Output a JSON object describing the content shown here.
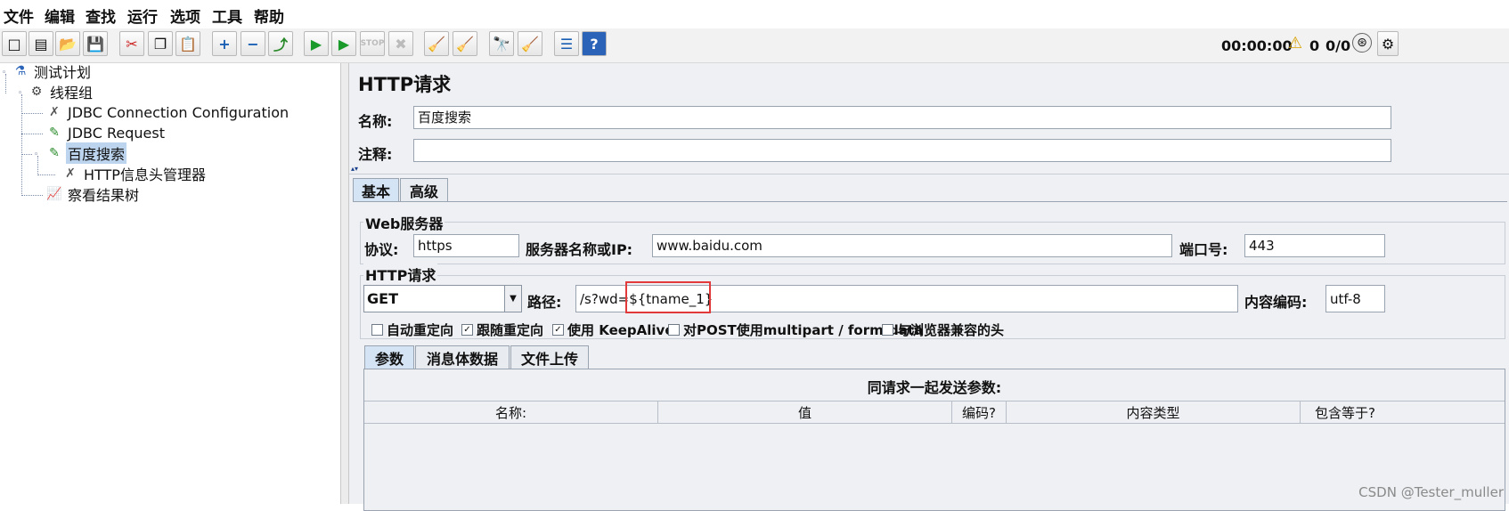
{
  "menu": [
    "文件",
    "编辑",
    "查找",
    "运行",
    "选项",
    "工具",
    "帮助"
  ],
  "status": {
    "elapsed": "00:00:00",
    "warning_count": "0",
    "threads": "0/0"
  },
  "tree": {
    "items": [
      {
        "label": "测试计划",
        "icon": "test-plan-icon"
      },
      {
        "label": "线程组",
        "icon": "gear-icon"
      },
      {
        "label": "JDBC Connection Configuration",
        "icon": "wrench-icon"
      },
      {
        "label": "JDBC Request",
        "icon": "pipette-icon"
      },
      {
        "label": "百度搜索",
        "icon": "pipette-icon",
        "selected": true
      },
      {
        "label": "HTTP信息头管理器",
        "icon": "wrench-icon"
      },
      {
        "label": "察看结果树",
        "icon": "chart-icon"
      }
    ]
  },
  "panel": {
    "title": "HTTP请求",
    "name_label": "名称:",
    "name_value": "百度搜索",
    "comment_label": "注释:",
    "comment_value": "",
    "tabs": [
      "基本",
      "高级"
    ],
    "web_server": {
      "group_title": "Web服务器",
      "protocol_label": "协议:",
      "protocol_value": "https",
      "server_label": "服务器名称或IP:",
      "server_value": "www.baidu.com",
      "port_label": "端口号:",
      "port_value": "443"
    },
    "http_request": {
      "group_title": "HTTP请求",
      "method": "GET",
      "path_label": "路径:",
      "path_prefix": "/s?wd=",
      "path_var": "${tname_1}",
      "encoding_label": "内容编码:",
      "encoding_value": "utf-8",
      "options": [
        {
          "label": "自动重定向",
          "checked": false
        },
        {
          "label": "跟随重定向",
          "checked": true
        },
        {
          "label": "使用 KeepAlive",
          "checked": true
        },
        {
          "label": "对POST使用multipart / form-data",
          "checked": false
        },
        {
          "label": "与浏览器兼容的头",
          "checked": false
        }
      ]
    },
    "sub_tabs": [
      "参数",
      "消息体数据",
      "文件上传"
    ],
    "params": {
      "caption": "同请求一起发送参数:",
      "columns": [
        "名称:",
        "值",
        "编码?",
        "内容类型",
        "包含等于?"
      ]
    }
  },
  "watermark": "CSDN @Tester_muller",
  "colors": {
    "highlight": "#e23a3a",
    "selection": "#bcd4ee",
    "panel_bg": "#eef0f3"
  }
}
